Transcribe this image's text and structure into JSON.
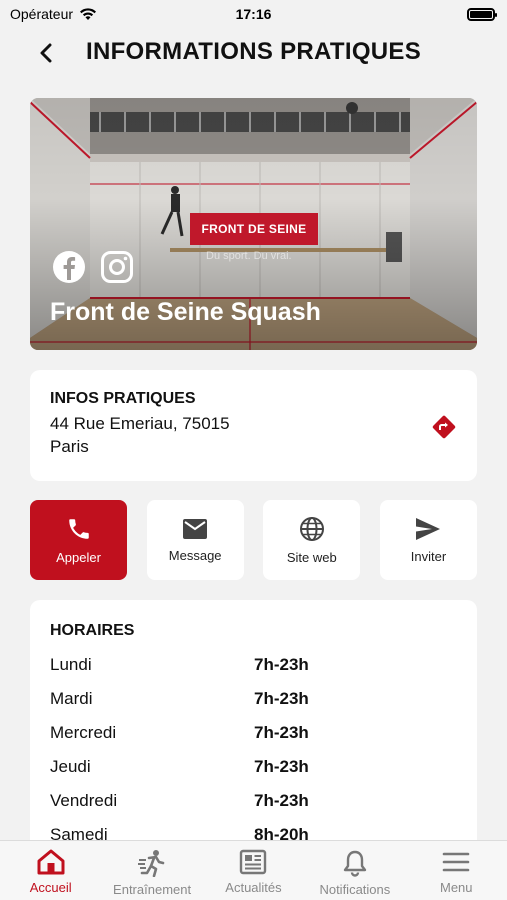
{
  "status_bar": {
    "carrier": "Opérateur",
    "time": "17:16"
  },
  "header": {
    "title": "INFORMATIONS PRATIQUES"
  },
  "hero": {
    "club_name": "Front de Seine Squash",
    "sign_text": "FRONT DE SEINE",
    "tagline": "Du sport. Du vrai.",
    "social": [
      "facebook-icon",
      "instagram-icon"
    ]
  },
  "info": {
    "title": "INFOS PRATIQUES",
    "address_line1": "44 Rue Emeriau, 75015",
    "address_line2": "Paris"
  },
  "actions": [
    {
      "label": "Appeler",
      "icon": "phone-icon"
    },
    {
      "label": "Message",
      "icon": "mail-icon"
    },
    {
      "label": "Site web",
      "icon": "globe-icon"
    },
    {
      "label": "Inviter",
      "icon": "send-icon"
    }
  ],
  "hours": {
    "title": "HORAIRES",
    "rows": [
      {
        "day": "Lundi",
        "time": "7h-23h"
      },
      {
        "day": "Mardi",
        "time": "7h-23h"
      },
      {
        "day": "Mercredi",
        "time": "7h-23h"
      },
      {
        "day": "Jeudi",
        "time": "7h-23h"
      },
      {
        "day": "Vendredi",
        "time": "7h-23h"
      },
      {
        "day": "Samedi",
        "time": "8h-20h"
      }
    ]
  },
  "tabbar": {
    "items": [
      {
        "label": "Accueil",
        "icon": "home-icon",
        "active": true
      },
      {
        "label": "Entraînement",
        "icon": "running-icon"
      },
      {
        "label": "Actualités",
        "icon": "news-icon"
      },
      {
        "label": "Notifications",
        "icon": "bell-icon"
      },
      {
        "label": "Menu",
        "icon": "menu-icon"
      }
    ]
  },
  "colors": {
    "accent": "#c0101e",
    "background": "#f2f2f2",
    "card": "#ffffff"
  }
}
